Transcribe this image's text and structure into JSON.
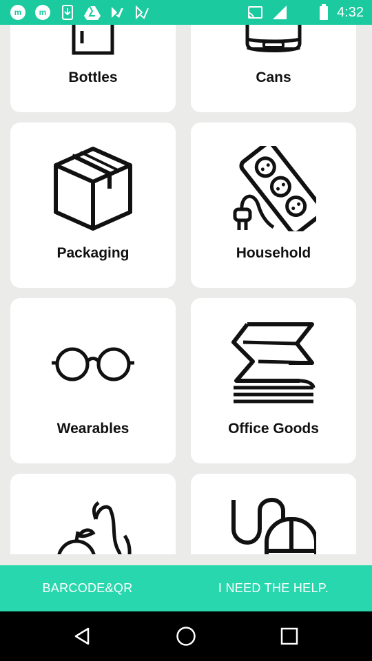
{
  "status_bar": {
    "time": "4:32",
    "left_icons": [
      "m-app-icon",
      "m-app-icon-2",
      "download-icon",
      "drive-icon",
      "play-store-icon",
      "play-store-icon-2"
    ],
    "right_icons": [
      "cast-icon",
      "signal-icon",
      "battery-icon"
    ]
  },
  "categories": [
    {
      "label": "Bottles",
      "icon": "bottle-icon"
    },
    {
      "label": "Cans",
      "icon": "can-icon"
    },
    {
      "label": "Packaging",
      "icon": "box-icon"
    },
    {
      "label": "Household",
      "icon": "power-strip-icon"
    },
    {
      "label": "Wearables",
      "icon": "glasses-icon"
    },
    {
      "label": "Office Goods",
      "icon": "paper-stack-icon"
    },
    {
      "label": "",
      "icon": "fruit-icon"
    },
    {
      "label": "",
      "icon": "mouse-icon"
    }
  ],
  "bottom_bar": {
    "left_label": "BARCODE&QR",
    "right_label": "I NEED THE HELP."
  },
  "nav_bar": {
    "buttons": [
      "back-icon",
      "home-icon",
      "recents-icon"
    ]
  }
}
